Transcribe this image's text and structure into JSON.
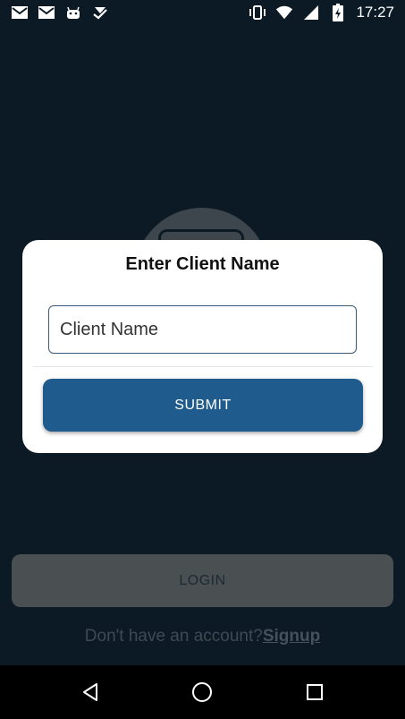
{
  "status_bar": {
    "time": "17:27",
    "left_icons": [
      "mail-icon",
      "mail-icon",
      "android-icon",
      "download-check-icon"
    ],
    "right_icons": [
      "vibrate-icon",
      "wifi-icon",
      "signal-icon",
      "battery-icon"
    ]
  },
  "dialog": {
    "title": "Enter Client Name",
    "input_placeholder": "Client Name",
    "submit_label": "SUBMIT"
  },
  "background": {
    "login_label": "LOGIN",
    "signup_prompt": "Don't have an account?",
    "signup_link": "Signup"
  },
  "nav_bar": {
    "buttons": [
      "back-icon",
      "home-icon",
      "recents-icon"
    ]
  },
  "colors": {
    "background": "#0c1a25",
    "submit_button": "#1f5b8c",
    "dialog": "#ffffff"
  }
}
